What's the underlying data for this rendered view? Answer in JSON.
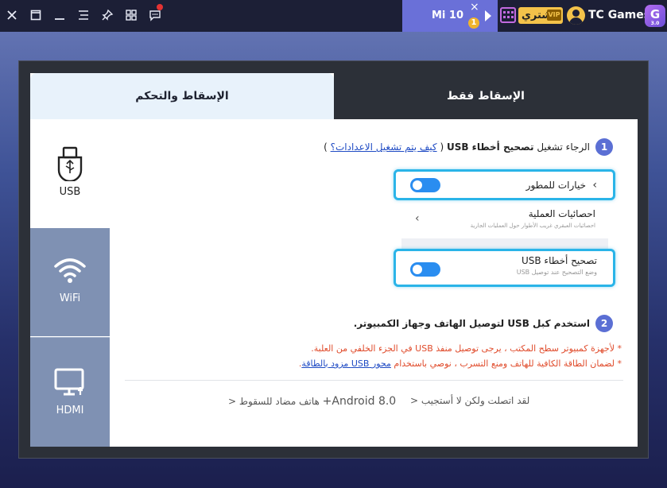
{
  "topbar": {
    "device_name": "Mi 10",
    "device_close": "×",
    "device_badge": "1",
    "buy_label": "اشتري",
    "vip_label": "VIP",
    "brand_name": "TC Games",
    "logo_text": "G",
    "logo_version": "3.0",
    "icons": [
      "close-icon",
      "maximize-icon",
      "minimize-icon",
      "menu-icon",
      "pin-icon",
      "grid-icon",
      "message-icon",
      "calendar-icon",
      "user-icon"
    ]
  },
  "tabs": {
    "left": "الإسقاط والتحكم",
    "right": "الإسقاط فقط"
  },
  "sidebar": {
    "usb": "USB",
    "wifi": "WiFi",
    "hdmi": "HDMI"
  },
  "step1": {
    "number": "1",
    "prefix": "الرجاء تشغيل",
    "bold": "تصحيح أخطاء USB",
    "open_paren": "(",
    "link": "كيف يتم تشغيل الاعدادات؟",
    "close_paren": ")"
  },
  "settings": {
    "developer_options": "خيارات للمطور",
    "process_stats_title": "احصائيات العملية",
    "process_stats_sub": "احصائيات العبقري غريب الأطوار حول العمليات الجارية",
    "usb_debug_title": "تصحيح أخطاء USB",
    "usb_debug_sub": "وضع التصحيح عند توصيل USB"
  },
  "step2": {
    "number": "2",
    "text": "استخدم كبل USB لتوصيل الهاتف وجهاز الكمبيوتر."
  },
  "notes": {
    "note1": "* لأجهزة كمبيوتر سطح المكتب ، يرجى توصيل منفذ USB في الجزء الخلفي من العلبة.",
    "note2_prefix": "* لضمان الطاقة الكافية للهاتف ومنع التسرب ، نوصي باستخدام",
    "note2_link": "محور USB مزود بالطاقة",
    "note2_suffix": "."
  },
  "footer": {
    "connected": "لقد اتصلت ولكن لا أستجيب",
    "android": "Android 8.0+",
    "android_suffix": "هاتف مضاد للسقوط",
    "arrow": "<"
  },
  "colors": {
    "accent": "#5b6fd4",
    "toggle": "#2a8df0",
    "highlight": "#2ab4e8",
    "sidebar_inactive": "#7f91b3",
    "warning": "#e04b2b",
    "link": "#1f4bc4"
  }
}
